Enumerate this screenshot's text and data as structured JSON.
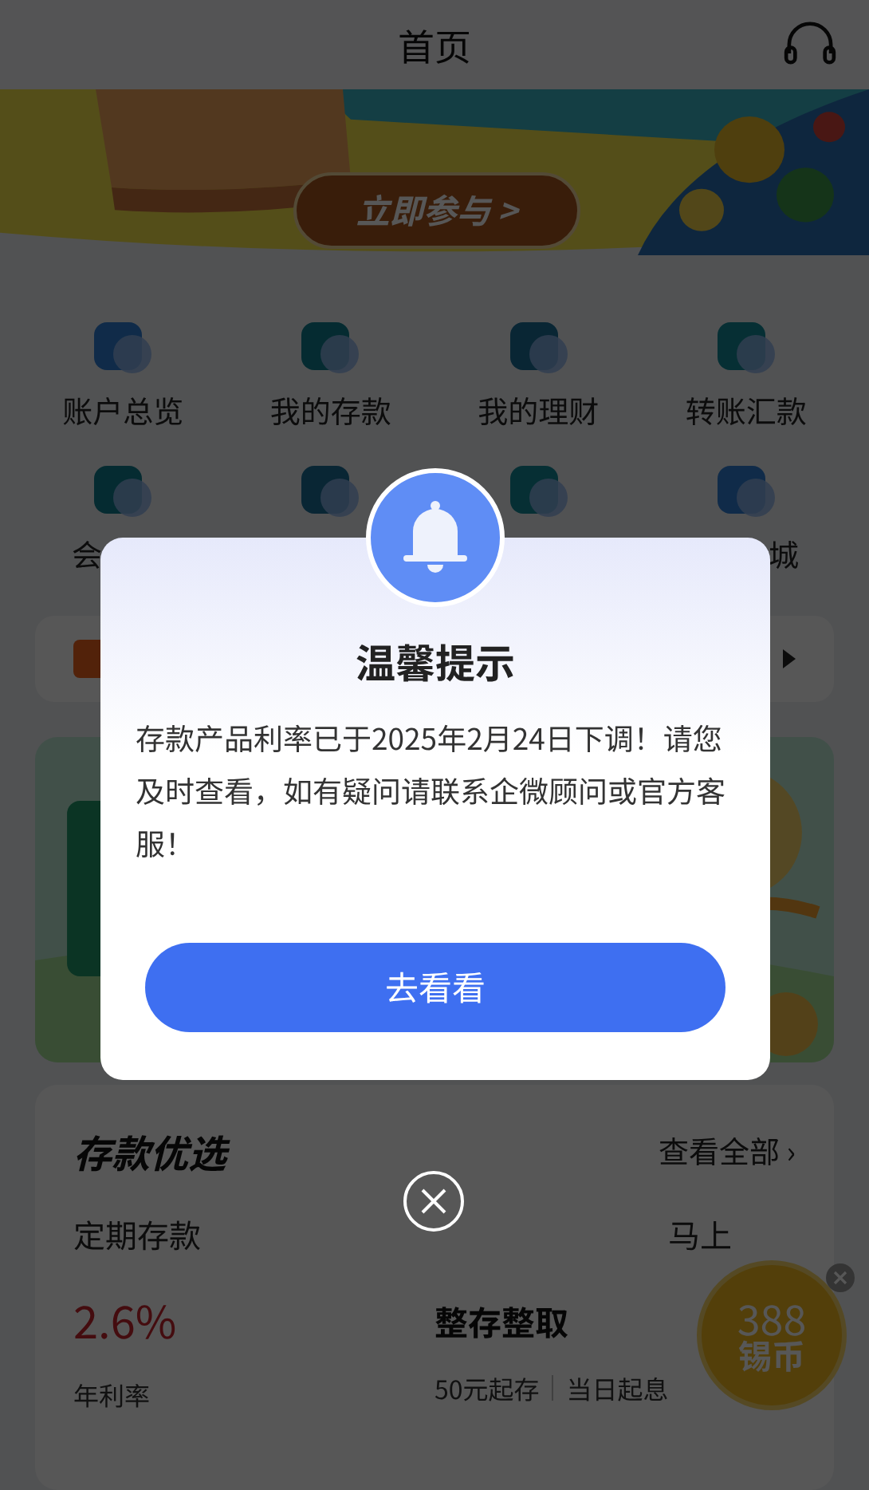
{
  "header": {
    "title": "首页"
  },
  "banner": {
    "kind": "picture",
    "button": "立即参与 >"
  },
  "shortcuts": [
    {
      "label": "账户总览"
    },
    {
      "label": "我的存款"
    },
    {
      "label": "我的理财"
    },
    {
      "label": "转账汇款"
    }
  ],
  "shortcuts_row2": {
    "first_label": "会",
    "last_label": "城"
  },
  "deposit_card": {
    "title": "存款优选",
    "link": "查看全部 ›",
    "product": "定期存款",
    "action": "马上",
    "rate": "2.6%",
    "rate_label": "年利率",
    "name": "整存整取",
    "terms": "50元起存",
    "terms_2": "当日起息"
  },
  "coin_badge": {
    "amount": "388",
    "unit": "锡币"
  },
  "dialog": {
    "title": "温馨提示",
    "message": "存款产品利率已于2025年2月24日下调！请您及时查看，如有疑问请联系企微顾问或官方客服！",
    "button": "去看看"
  }
}
